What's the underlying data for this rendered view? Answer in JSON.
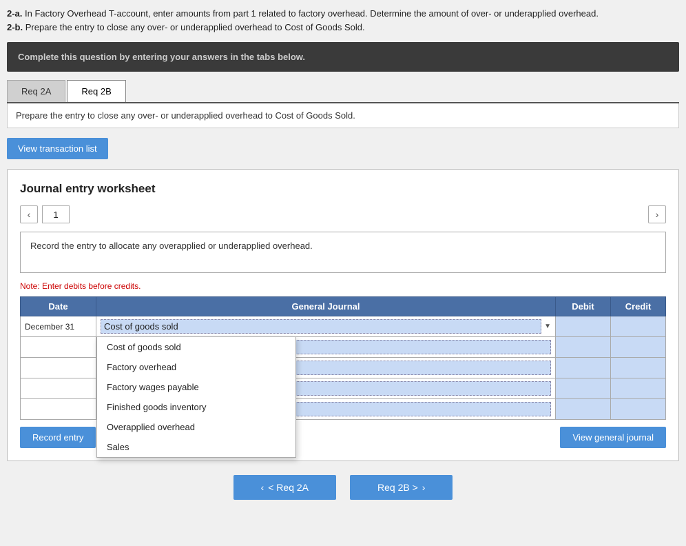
{
  "instructions": {
    "part2a_label": "2-a.",
    "part2a_text": " In Factory Overhead T-account, enter amounts from part 1 related to factory overhead. Determine the amount of over- or underapplied overhead.",
    "part2b_label": "2-b.",
    "part2b_text": " Prepare the entry to close any over- or underapplied overhead to Cost of Goods Sold."
  },
  "complete_box": {
    "text": "Complete this question by entering your answers in the tabs below."
  },
  "tabs": [
    {
      "id": "req2a",
      "label": "Req 2A"
    },
    {
      "id": "req2b",
      "label": "Req 2B"
    }
  ],
  "active_tab": "req2b",
  "req_description": "Prepare the entry to close any over- or underapplied overhead to Cost of Goods Sold.",
  "view_transaction_btn": "View transaction list",
  "worksheet": {
    "title": "Journal entry worksheet",
    "page_number": "1",
    "entry_description": "Record the entry to allocate any overapplied or underapplied overhead.",
    "note": "Note: Enter debits before credits.",
    "table": {
      "headers": [
        "Date",
        "General Journal",
        "Debit",
        "Credit"
      ],
      "rows": [
        {
          "date": "December 31",
          "gj": "Cost of goods sold",
          "debit": "",
          "credit": ""
        },
        {
          "date": "",
          "gj": "",
          "debit": "",
          "credit": ""
        },
        {
          "date": "",
          "gj": "",
          "debit": "",
          "credit": ""
        },
        {
          "date": "",
          "gj": "",
          "debit": "",
          "credit": ""
        },
        {
          "date": "",
          "gj": "",
          "debit": "",
          "credit": ""
        }
      ]
    },
    "dropdown_options": [
      "Cost of goods sold",
      "Factory overhead",
      "Factory wages payable",
      "Finished goods inventory",
      "Overapplied overhead",
      "Sales"
    ],
    "record_btn": "Record entry",
    "view_journal_btn": "View general journal"
  },
  "footer": {
    "prev_btn": "< Req 2A",
    "next_btn": "Req 2B >"
  }
}
